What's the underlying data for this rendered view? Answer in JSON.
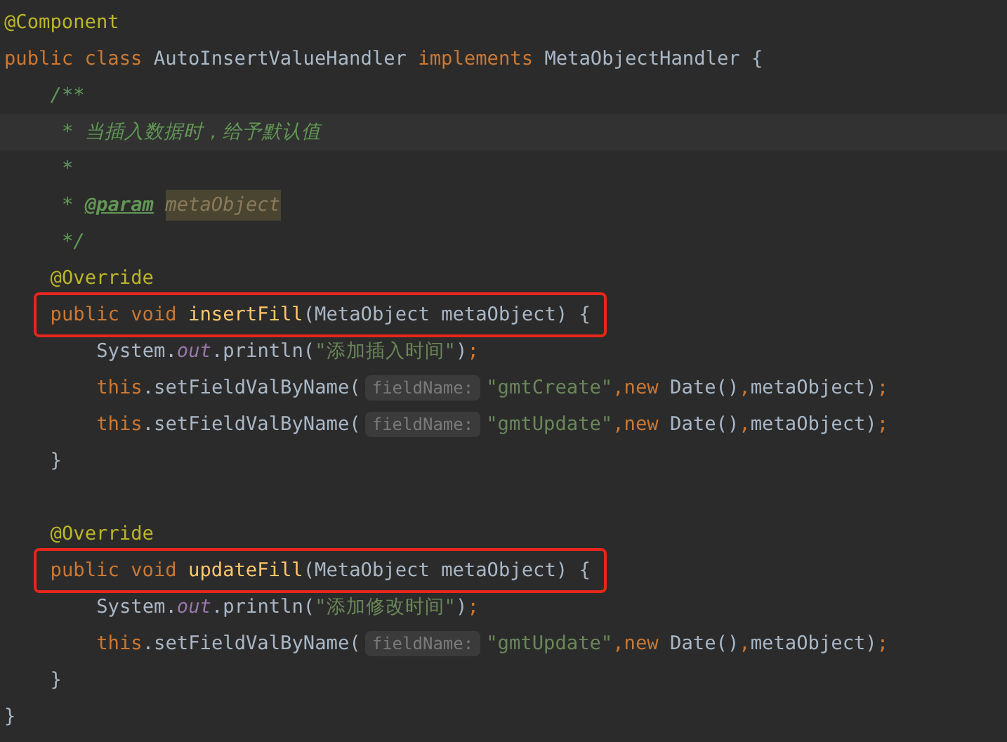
{
  "editor": {
    "lines": [
      {
        "kind": "code",
        "tokens": [
          {
            "kind": "annotation",
            "text": "@Component"
          }
        ]
      },
      {
        "kind": "code",
        "tokens": [
          {
            "kind": "keyword",
            "text": "public class "
          },
          {
            "kind": "plain",
            "text": "AutoInsertValueHandler "
          },
          {
            "kind": "keyword",
            "text": "implements "
          },
          {
            "kind": "plain",
            "text": "MetaObjectHandler {"
          }
        ],
        "children": [
          {
            "kind": "code",
            "tokens": [
              {
                "kind": "comment",
                "text": "/**"
              }
            ]
          },
          {
            "kind": "code",
            "current": true,
            "tokens": [
              {
                "kind": "comment",
                "text": " * 当插入数据时，给予默认值"
              }
            ]
          },
          {
            "kind": "code",
            "tokens": [
              {
                "kind": "comment",
                "text": " *"
              }
            ]
          },
          {
            "kind": "code",
            "tokens": [
              {
                "kind": "comment",
                "text": " * "
              },
              {
                "kind": "doc_tag",
                "text": "@param"
              },
              {
                "kind": "doc_param",
                "text": "metaObject"
              }
            ]
          },
          {
            "kind": "code",
            "tokens": [
              {
                "kind": "comment",
                "text": " */"
              }
            ]
          },
          {
            "kind": "code",
            "tokens": [
              {
                "kind": "annotation",
                "text": "@Override"
              }
            ]
          },
          {
            "kind": "code",
            "boxed": true,
            "tokens": [
              {
                "kind": "keyword",
                "text": "public void "
              },
              {
                "kind": "method",
                "text": "insertFill"
              },
              {
                "kind": "plain",
                "text": "(MetaObject metaObject) {"
              }
            ],
            "children": [
              {
                "kind": "code",
                "tokens": [
                  {
                    "kind": "plain",
                    "text": "System."
                  },
                  {
                    "kind": "static",
                    "text": "out"
                  },
                  {
                    "kind": "plain",
                    "text": ".println("
                  },
                  {
                    "kind": "string",
                    "text": "\"添加插入时间\""
                  },
                  {
                    "kind": "plain",
                    "text": ")"
                  },
                  {
                    "kind": "keyword",
                    "text": ";"
                  }
                ]
              },
              {
                "kind": "code",
                "tokens": [
                  {
                    "kind": "keyword",
                    "text": "this"
                  },
                  {
                    "kind": "plain",
                    "text": ".setFieldValByName("
                  },
                  {
                    "kind": "hint",
                    "text": "fieldName:"
                  },
                  {
                    "kind": "string",
                    "text": "\"gmtCreate\""
                  },
                  {
                    "kind": "keyword",
                    "text": ",new "
                  },
                  {
                    "kind": "plain",
                    "text": "Date()"
                  },
                  {
                    "kind": "keyword",
                    "text": ","
                  },
                  {
                    "kind": "plain",
                    "text": "metaObject)"
                  },
                  {
                    "kind": "keyword",
                    "text": ";"
                  }
                ]
              },
              {
                "kind": "code",
                "tokens": [
                  {
                    "kind": "keyword",
                    "text": "this"
                  },
                  {
                    "kind": "plain",
                    "text": ".setFieldValByName("
                  },
                  {
                    "kind": "hint",
                    "text": "fieldName:"
                  },
                  {
                    "kind": "string",
                    "text": "\"gmtUpdate\""
                  },
                  {
                    "kind": "keyword",
                    "text": ",new "
                  },
                  {
                    "kind": "plain",
                    "text": "Date()"
                  },
                  {
                    "kind": "keyword",
                    "text": ","
                  },
                  {
                    "kind": "plain",
                    "text": "metaObject)"
                  },
                  {
                    "kind": "keyword",
                    "text": ";"
                  }
                ]
              }
            ]
          },
          {
            "kind": "code",
            "tokens": [
              {
                "kind": "plain",
                "text": "}"
              }
            ]
          },
          {
            "kind": "blank"
          },
          {
            "kind": "code",
            "tokens": [
              {
                "kind": "annotation",
                "text": "@Override"
              }
            ]
          },
          {
            "kind": "code",
            "boxed": true,
            "tokens": [
              {
                "kind": "keyword",
                "text": "public void "
              },
              {
                "kind": "method",
                "text": "updateFill"
              },
              {
                "kind": "plain",
                "text": "(MetaObject metaObject) {"
              }
            ],
            "children": [
              {
                "kind": "code",
                "tokens": [
                  {
                    "kind": "plain",
                    "text": "System."
                  },
                  {
                    "kind": "static",
                    "text": "out"
                  },
                  {
                    "kind": "plain",
                    "text": ".println("
                  },
                  {
                    "kind": "string",
                    "text": "\"添加修改时间\""
                  },
                  {
                    "kind": "plain",
                    "text": ")"
                  },
                  {
                    "kind": "keyword",
                    "text": ";"
                  }
                ]
              },
              {
                "kind": "code",
                "tokens": [
                  {
                    "kind": "keyword",
                    "text": "this"
                  },
                  {
                    "kind": "plain",
                    "text": ".setFieldValByName("
                  },
                  {
                    "kind": "hint",
                    "text": "fieldName:"
                  },
                  {
                    "kind": "string",
                    "text": "\"gmtUpdate\""
                  },
                  {
                    "kind": "keyword",
                    "text": ",new "
                  },
                  {
                    "kind": "plain",
                    "text": "Date()"
                  },
                  {
                    "kind": "keyword",
                    "text": ","
                  },
                  {
                    "kind": "plain",
                    "text": "metaObject)"
                  },
                  {
                    "kind": "keyword",
                    "text": ";"
                  }
                ]
              }
            ]
          },
          {
            "kind": "code",
            "tokens": [
              {
                "kind": "plain",
                "text": "}"
              }
            ]
          }
        ]
      },
      {
        "kind": "code",
        "tokens": [
          {
            "kind": "plain",
            "text": "}"
          }
        ]
      }
    ]
  }
}
